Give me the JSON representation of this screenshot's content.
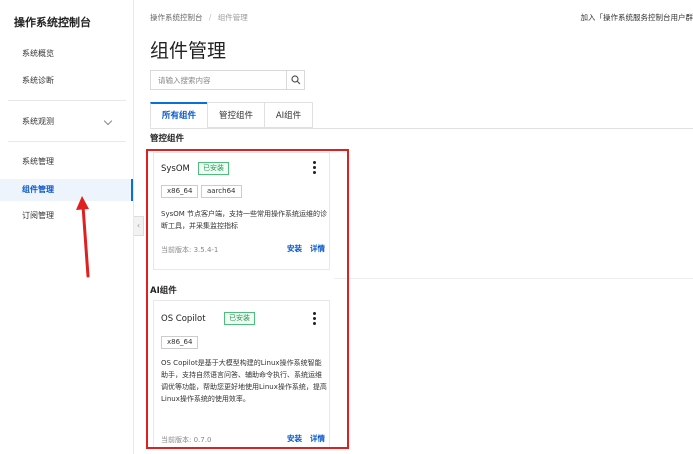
{
  "sidebar": {
    "title": "操作系统控制台",
    "items": [
      {
        "label": "系统概览"
      },
      {
        "label": "系统诊断"
      },
      {
        "label": "系统观测"
      },
      {
        "label": "系统管理"
      },
      {
        "label": "组件管理"
      },
      {
        "label": "订阅管理"
      }
    ],
    "active_item": "组件管理"
  },
  "breadcrumb": {
    "root": "操作系统控制台",
    "separator": "/",
    "current": "组件管理"
  },
  "top_right_text": "加入「操作系统服务控制台用户群",
  "page_title": "组件管理",
  "search": {
    "placeholder": "请输入搜索内容",
    "icon": "search-icon"
  },
  "tabs": [
    {
      "label": "所有组件",
      "active": true
    },
    {
      "label": "管控组件",
      "active": false
    },
    {
      "label": "AI组件",
      "active": false
    }
  ],
  "sections": [
    {
      "title": "管控组件",
      "card": {
        "name": "SysOM",
        "status": "已安装",
        "tags": [
          "x86_64",
          "aarch64"
        ],
        "description": "SysOM 节点客户端，支持一些常用操作系统运维的诊断工具，并采集监控指标",
        "version_label": "当前版本: 3.5.4-1",
        "actions": {
          "install": "安装",
          "details": "详情"
        }
      }
    },
    {
      "title": "AI组件",
      "card": {
        "name": "OS Copilot",
        "status": "已安装",
        "tags": [
          "x86_64"
        ],
        "description": "OS Copilot是基于大模型构建的Linux操作系统智能助手，支持自然语言问答、辅助命令执行、系统运维调优等功能，帮助您更好地使用Linux操作系统，提高Linux操作系统的使用效率。",
        "version_label": "当前版本: 0.7.0",
        "actions": {
          "install": "安装",
          "details": "详情"
        }
      }
    }
  ],
  "colors": {
    "accent": "#0a6fd8",
    "installed_green": "#1a9e4b",
    "annotation_red": "#e02020"
  }
}
